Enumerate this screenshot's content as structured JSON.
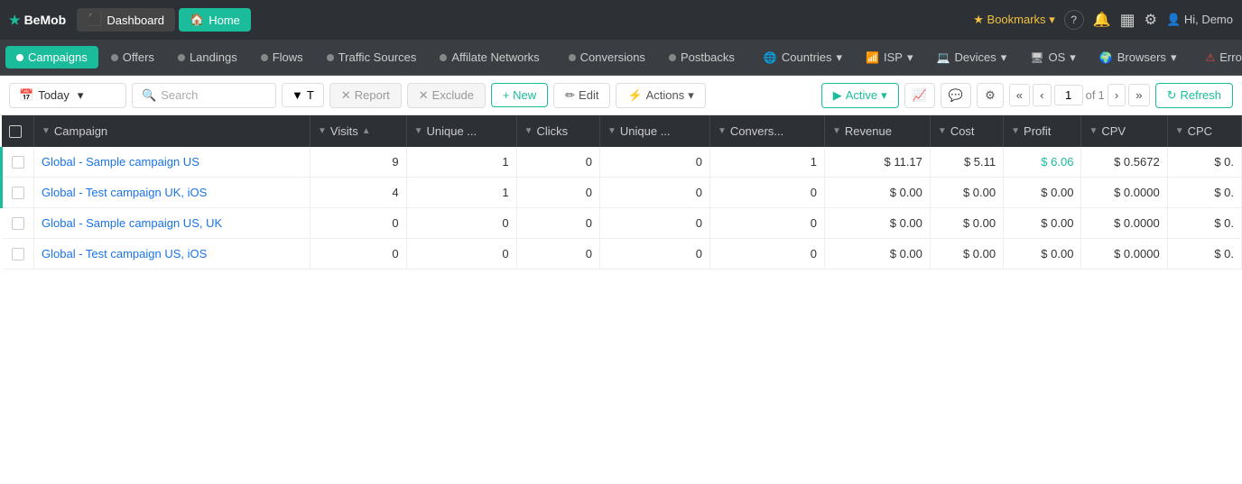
{
  "topNav": {
    "logo": "BeMob",
    "logoIcon": "★",
    "buttons": [
      {
        "label": "Dashboard",
        "type": "dashboard",
        "icon": "⬛"
      },
      {
        "label": "Home",
        "type": "active",
        "icon": "🏠"
      }
    ],
    "right": {
      "bookmarks": "Bookmarks",
      "helpIcon": "?",
      "notifIcon": "🔔",
      "calIcon": "📅",
      "settingsIcon": "⚙",
      "userLabel": "Hi, Demo"
    }
  },
  "secondNav": {
    "items": [
      {
        "label": "Campaigns",
        "active": true,
        "hasDot": true
      },
      {
        "label": "Offers",
        "hasDot": true
      },
      {
        "label": "Landings",
        "hasDot": true
      },
      {
        "label": "Flows",
        "hasDot": true
      },
      {
        "label": "Traffic Sources",
        "hasDot": true
      },
      {
        "label": "Affilate Networks",
        "hasDot": true
      },
      {
        "label": "Conversions",
        "hasDot": true
      },
      {
        "label": "Postbacks",
        "hasDot": true
      },
      {
        "label": "Countries",
        "hasDot": true,
        "hasArrow": true
      },
      {
        "label": "ISP",
        "hasDot": true,
        "hasArrow": true
      },
      {
        "label": "Devices",
        "hasDot": true,
        "hasArrow": true
      },
      {
        "label": "OS",
        "hasDot": true,
        "hasArrow": true
      },
      {
        "label": "Browsers",
        "hasDot": true,
        "hasArrow": true
      },
      {
        "label": "Errors",
        "hasDot": true
      }
    ]
  },
  "toolbar": {
    "datePicker": "Today",
    "searchPlaceholder": "Search",
    "filterLabel": "T",
    "reportLabel": "Report",
    "excludeLabel": "Exclude",
    "newLabel": "+ New",
    "editLabel": "Edit",
    "actionsLabel": "Actions",
    "activeLabel": "Active",
    "refreshLabel": "Refresh",
    "pageNum": "1",
    "pageTotal": "1"
  },
  "table": {
    "columns": [
      {
        "id": "check",
        "label": ""
      },
      {
        "id": "campaign",
        "label": "Campaign",
        "sortable": true
      },
      {
        "id": "visits",
        "label": "Visits",
        "sortable": true
      },
      {
        "id": "unique_v",
        "label": "Unique ...",
        "sortable": true
      },
      {
        "id": "clicks",
        "label": "Clicks",
        "sortable": true
      },
      {
        "id": "unique_c",
        "label": "Unique ...",
        "sortable": true
      },
      {
        "id": "conversions",
        "label": "Convers...",
        "sortable": true
      },
      {
        "id": "revenue",
        "label": "Revenue",
        "sortable": true
      },
      {
        "id": "cost",
        "label": "Cost",
        "sortable": true
      },
      {
        "id": "profit",
        "label": "Profit",
        "sortable": true
      },
      {
        "id": "cpv",
        "label": "CPV",
        "sortable": true
      },
      {
        "id": "cpc",
        "label": "CPC",
        "sortable": true
      }
    ],
    "rows": [
      {
        "campaign": "Global - Sample campaign US",
        "visits": "9",
        "unique_v": "1",
        "clicks": "0",
        "unique_c": "0",
        "conversions": "1",
        "revenue": "$ 11.17",
        "cost": "$ 5.11",
        "profit": "$ 6.06",
        "cpv": "$ 0.5672",
        "cpc": "$ 0.",
        "profitPositive": true,
        "indicator": "green"
      },
      {
        "campaign": "Global - Test campaign UK, iOS",
        "visits": "4",
        "unique_v": "1",
        "clicks": "0",
        "unique_c": "0",
        "conversions": "0",
        "revenue": "$ 0.00",
        "cost": "$ 0.00",
        "profit": "$ 0.00",
        "cpv": "$ 0.0000",
        "cpc": "$ 0.",
        "profitPositive": false,
        "indicator": "green"
      },
      {
        "campaign": "Global - Sample campaign US, UK",
        "visits": "0",
        "unique_v": "0",
        "clicks": "0",
        "unique_c": "0",
        "conversions": "0",
        "revenue": "$ 0.00",
        "cost": "$ 0.00",
        "profit": "$ 0.00",
        "cpv": "$ 0.0000",
        "cpc": "$ 0.",
        "profitPositive": false,
        "indicator": "none"
      },
      {
        "campaign": "Global - Test campaign US, iOS",
        "visits": "0",
        "unique_v": "0",
        "clicks": "0",
        "unique_c": "0",
        "conversions": "0",
        "revenue": "$ 0.00",
        "cost": "$ 0.00",
        "profit": "$ 0.00",
        "cpv": "$ 0.0000",
        "cpc": "$ 0.",
        "profitPositive": false,
        "indicator": "none"
      }
    ]
  }
}
